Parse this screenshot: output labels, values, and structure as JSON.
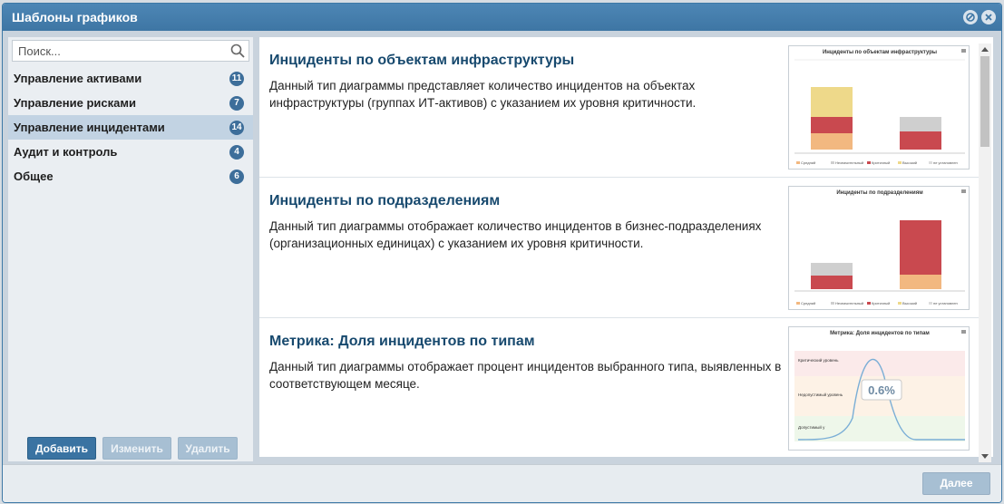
{
  "window": {
    "title": "Шаблоны графиков"
  },
  "search": {
    "placeholder": "Поиск..."
  },
  "sidebar": {
    "items": [
      {
        "label": "Управление активами",
        "count": "11"
      },
      {
        "label": "Управление рисками",
        "count": "7"
      },
      {
        "label": "Управление инцидентами",
        "count": "14",
        "active": true
      },
      {
        "label": "Аудит и контроль",
        "count": "4"
      },
      {
        "label": "Общее",
        "count": "6"
      }
    ],
    "buttons": {
      "add": "Добавить",
      "edit": "Изменить",
      "delete": "Удалить"
    }
  },
  "cards": [
    {
      "title": "Инциденты по объектам инфраструктуры",
      "description": "Данный тип диаграммы представляет количество инцидентов на объектах инфраструктуры (группах ИТ-активов) с указанием их уровня критичности.",
      "thumb_title": "Инциденты по объектам инфраструктуры"
    },
    {
      "title": "Инциденты по подразделениям",
      "description": "Данный тип диаграммы отображает количество инцидентов в бизнес-подразделениях (организационных единицах) с указанием их уровня критичности.",
      "thumb_title": "Инциденты по подразделениям"
    },
    {
      "title": "Метрика: Доля инцидентов по типам",
      "description": "Данный тип диаграммы отображает процент инцидентов выбранного типа, выявленных в соответствующем месяце.",
      "thumb_title": "Метрика: Доля инцидентов по типам",
      "thumb_value": "0.6%"
    }
  ],
  "legend": [
    "Средний",
    "Незначительный",
    "Критичный",
    "Высокий",
    "не установлен"
  ],
  "zones": [
    "Критический уровень",
    "Недопустимый уровень",
    "Допустимый у"
  ],
  "footer": {
    "next": "Далее"
  },
  "colors": {
    "accent": "#3d78a6",
    "critical": "#c9494f",
    "high": "#f2b880",
    "medium": "#eed98a",
    "low": "#cfcfcf"
  }
}
